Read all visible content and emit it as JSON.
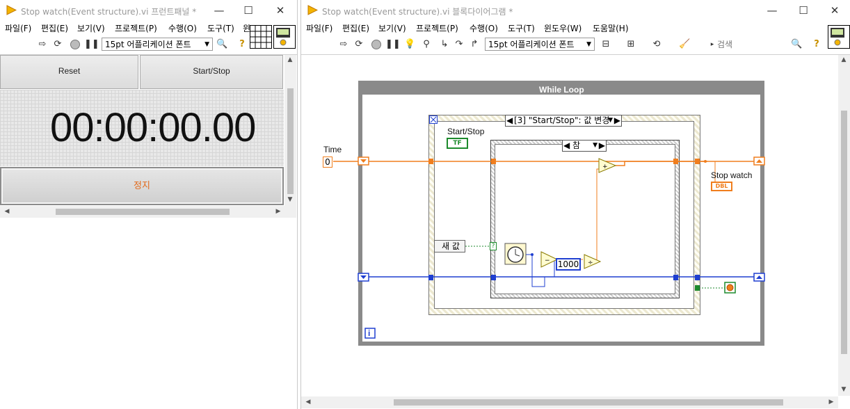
{
  "front_panel": {
    "title": "Stop watch(Event structure).vi 프런트패널 *",
    "menu": [
      "파일(F)",
      "편집(E)",
      "보기(V)",
      "프로젝트(P)",
      "수행(O)",
      "도구(T)",
      "윈"
    ],
    "font_select": "15pt 어플리케이션 폰트",
    "controls": {
      "reset_label": "Reset",
      "start_stop_label": "Start/Stop",
      "time_display": "00:00:00.00",
      "stop_label": "정지"
    }
  },
  "block_diagram": {
    "title": "Stop watch(Event structure).vi 블록다이어그램 *",
    "menu": [
      "파일(F)",
      "편집(E)",
      "보기(V)",
      "프로젝트(P)",
      "수행(O)",
      "도구(T)",
      "윈도우(W)",
      "도움말(H)"
    ],
    "font_select": "15pt 어플리케이션 폰트",
    "search_placeholder": "검색",
    "while_loop_title": "While Loop",
    "event_selector": "[3] \"Start/Stop\": 값 변경",
    "case_selector": "참",
    "labels": {
      "time": "Time",
      "time_const": "0",
      "start_stop": "Start/Stop",
      "tf": "TF",
      "new_value": "새 값",
      "constant_1000": "1000",
      "stop_watch": "Stop watch",
      "dbl": "DBL",
      "info": "i"
    }
  },
  "colors": {
    "orange_wire": "#f07e1e",
    "blue_wire": "#1f3fd1",
    "green_bool": "#1c8a2c",
    "loop_gray": "#8a8a8a",
    "stop_text": "#e2691a"
  }
}
